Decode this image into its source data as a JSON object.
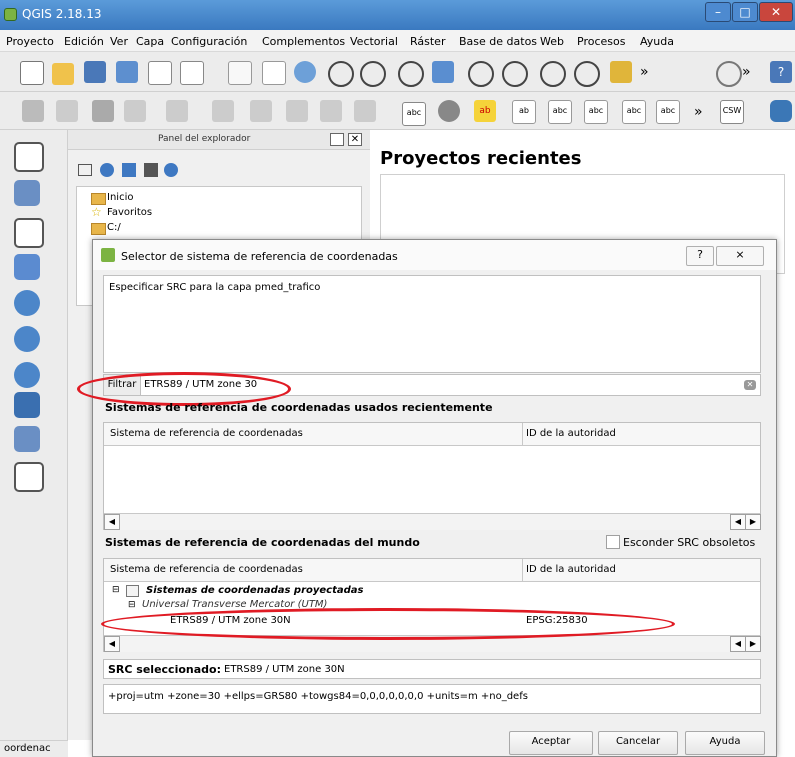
{
  "window": {
    "title": "QGIS 2.18.13"
  },
  "menu": [
    "Proyecto",
    "Edición",
    "Ver",
    "Capa",
    "Configuración",
    "Complementos",
    "Vectorial",
    "Ráster",
    "Base de datos",
    "Web",
    "Procesos",
    "Ayuda"
  ],
  "toolbar": {
    "overflow": "»",
    "label_abc": "abc",
    "label_ab": "ab",
    "label_csw": "CSW"
  },
  "browser": {
    "title": "Panel del explorador",
    "items": [
      "Inicio",
      "Favoritos",
      "C:/"
    ]
  },
  "recent": {
    "title": "Proyectos recientes"
  },
  "status": {
    "coordinate_label": "oordenac"
  },
  "dialog": {
    "title": "Selector de sistema de referencia de coordenadas",
    "description": "Especificar SRC para la capa pmed_trafico",
    "filter_label": "Filtrar",
    "filter_value": "ETRS89 / UTM zone 30",
    "recent_section": "Sistemas de referencia de coordenadas usados recientemente",
    "col_crs": "Sistema de referencia de coordenadas",
    "col_authority": "ID de la autoridad",
    "world_section": "Sistemas de referencia de coordenadas del mundo",
    "hide_obsolete": "Esconder SRC obsoletos",
    "tree": {
      "group": "Sistemas de coordenadas proyectadas",
      "subgroup": "Universal Transverse Mercator (UTM)",
      "item": "ETRS89 / UTM zone 30N",
      "item_id": "EPSG:25830"
    },
    "selected_label": "SRC seleccionado:",
    "selected_value": "ETRS89 / UTM zone 30N",
    "proj_string": "+proj=utm +zone=30 +ellps=GRS80 +towgs84=0,0,0,0,0,0,0 +units=m +no_defs",
    "buttons": {
      "accept": "Aceptar",
      "cancel": "Cancelar",
      "help": "Ayuda"
    },
    "help_icon": "?",
    "close_icon": "⨯"
  },
  "colors": {
    "highlight_oval": "#e01b24",
    "titlebar": "#3a79c0"
  }
}
